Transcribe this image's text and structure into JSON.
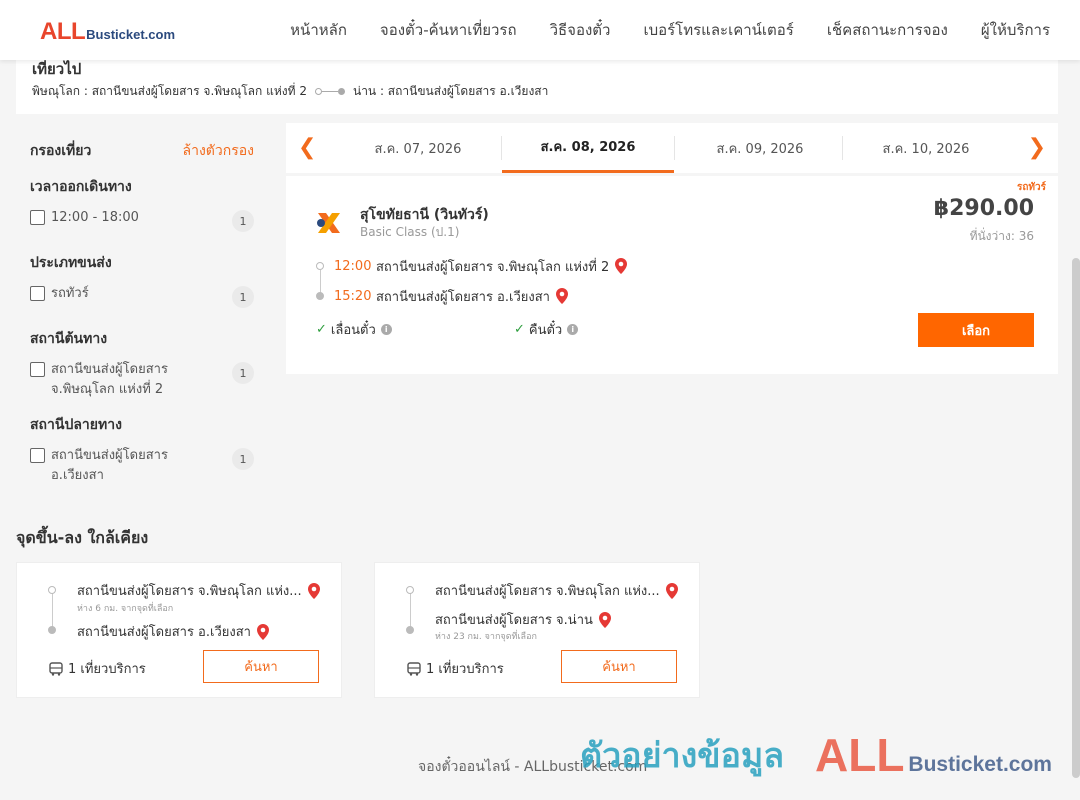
{
  "brand": {
    "logo_main": "ALL",
    "logo_rest": "Busticket.com"
  },
  "nav": [
    {
      "label": "หน้าหลัก"
    },
    {
      "label": "จองตั๋ว-ค้นหาเที่ยวรถ"
    },
    {
      "label": "วิธีจองตั๋ว"
    },
    {
      "label": "เบอร์โทรและเคาน์เตอร์"
    },
    {
      "label": "เช็คสถานะการจอง"
    },
    {
      "label": "ผู้ให้บริการ"
    }
  ],
  "route": {
    "title": "เที่ยวไป",
    "from": "พิษณุโลก : สถานีขนส่งผู้โดยสาร จ.พิษณุโลก แห่งที่ 2",
    "to": "น่าน : สถานีขนส่งผู้โดยสาร อ.เวียงสา"
  },
  "filter": {
    "title": "กรองเที่ยว",
    "clear": "ล้างตัวกรอง",
    "groups": [
      {
        "title": "เวลาออกเดินทาง",
        "option": "12:00 - 18:00",
        "count": "1"
      },
      {
        "title": "ประเภทขนส่ง",
        "option": "รถทัวร์",
        "count": "1"
      },
      {
        "title": "สถานีต้นทาง",
        "option": "สถานีขนส่งผู้โดยสาร จ.พิษณุโลก แห่งที่ 2",
        "count": "1"
      },
      {
        "title": "สถานีปลายทาง",
        "option": "สถานีขนส่งผู้โดยสาร อ.เวียงสา",
        "count": "1"
      }
    ]
  },
  "dates": [
    "ส.ค. 07, 2026",
    "ส.ค. 08, 2026",
    "ส.ค. 09, 2026",
    "ส.ค. 10, 2026"
  ],
  "trip": {
    "type": "รถทัวร์",
    "operator": "สุโขทัยธานี (วินทัวร์)",
    "class": "Basic Class (ป.1)",
    "price": "฿290.00",
    "seats": "ที่นั่งว่าง: 36",
    "depart_time": "12:00",
    "depart_station": "สถานีขนส่งผู้โดยสาร จ.พิษณุโลก แห่งที่ 2",
    "arrive_time": "15:20",
    "arrive_station": "สถานีขนส่งผู้โดยสาร อ.เวียงสา",
    "feature_1": "เลื่อนตั๋ว",
    "feature_2": "คืนตั๋ว",
    "select": "เลือก"
  },
  "nearby": {
    "title": "จุดขึ้น-ลง ใกล้เคียง",
    "cards": [
      {
        "from": "สถานีขนส่งผู้โดยสาร จ.พิษณุโลก แห่ง...",
        "from_dist": "ห่าง 6 กม. จากจุดที่เลือก",
        "to": "สถานีขนส่งผู้โดยสาร อ.เวียงสา",
        "to_dist": "",
        "services": "1 เที่ยวบริการ",
        "search": "ค้นหา"
      },
      {
        "from": "สถานีขนส่งผู้โดยสาร จ.พิษณุโลก แห่ง...",
        "from_dist": "",
        "to": "สถานีขนส่งผู้โดยสาร จ.น่าน",
        "to_dist": "ห่าง 23 กม. จากจุดที่เลือก",
        "services": "1 เที่ยวบริการ",
        "search": "ค้นหา"
      }
    ]
  },
  "footer": "จองตั๋วออนไลน์ - ALLbusticket.com",
  "watermark": {
    "thai": "ตัวอย่างข้อมูล",
    "logo_main": "ALL",
    "logo_rest": "Busticket.com"
  },
  "colors": {
    "accent": "#f26b1d",
    "button": "#ff6600",
    "brand_red": "#e8452c",
    "brand_blue": "#2b4a7e"
  }
}
